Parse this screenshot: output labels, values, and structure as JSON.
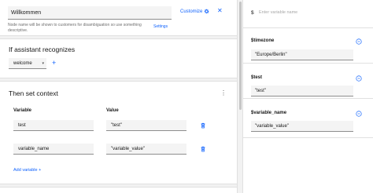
{
  "node": {
    "name": "Willkommen",
    "customize_label": "Customize",
    "helper_text": "Node name will be shown to customers for disambiguation so use something descriptive.",
    "settings_label": "Settings"
  },
  "recognizes": {
    "heading": "If assistant recognizes",
    "condition": "welcome"
  },
  "context": {
    "heading": "Then set context",
    "col_variable": "Variable",
    "col_value": "Value",
    "rows": [
      {
        "variable": "test",
        "value": "\"test\""
      },
      {
        "variable": "variable_name",
        "value": "\"variable_value\""
      }
    ],
    "add_label": "Add variable"
  },
  "context_panel": {
    "dollar": "$",
    "search_placeholder": "Enter variable name",
    "variables": [
      {
        "name": "$timezone",
        "value": "\"Europe/Berlin\""
      },
      {
        "name": "$test",
        "value": "\"test\""
      },
      {
        "name": "$variable_name",
        "value": "\"variable_value\""
      }
    ]
  },
  "colors": {
    "accent": "#0f62fe"
  }
}
